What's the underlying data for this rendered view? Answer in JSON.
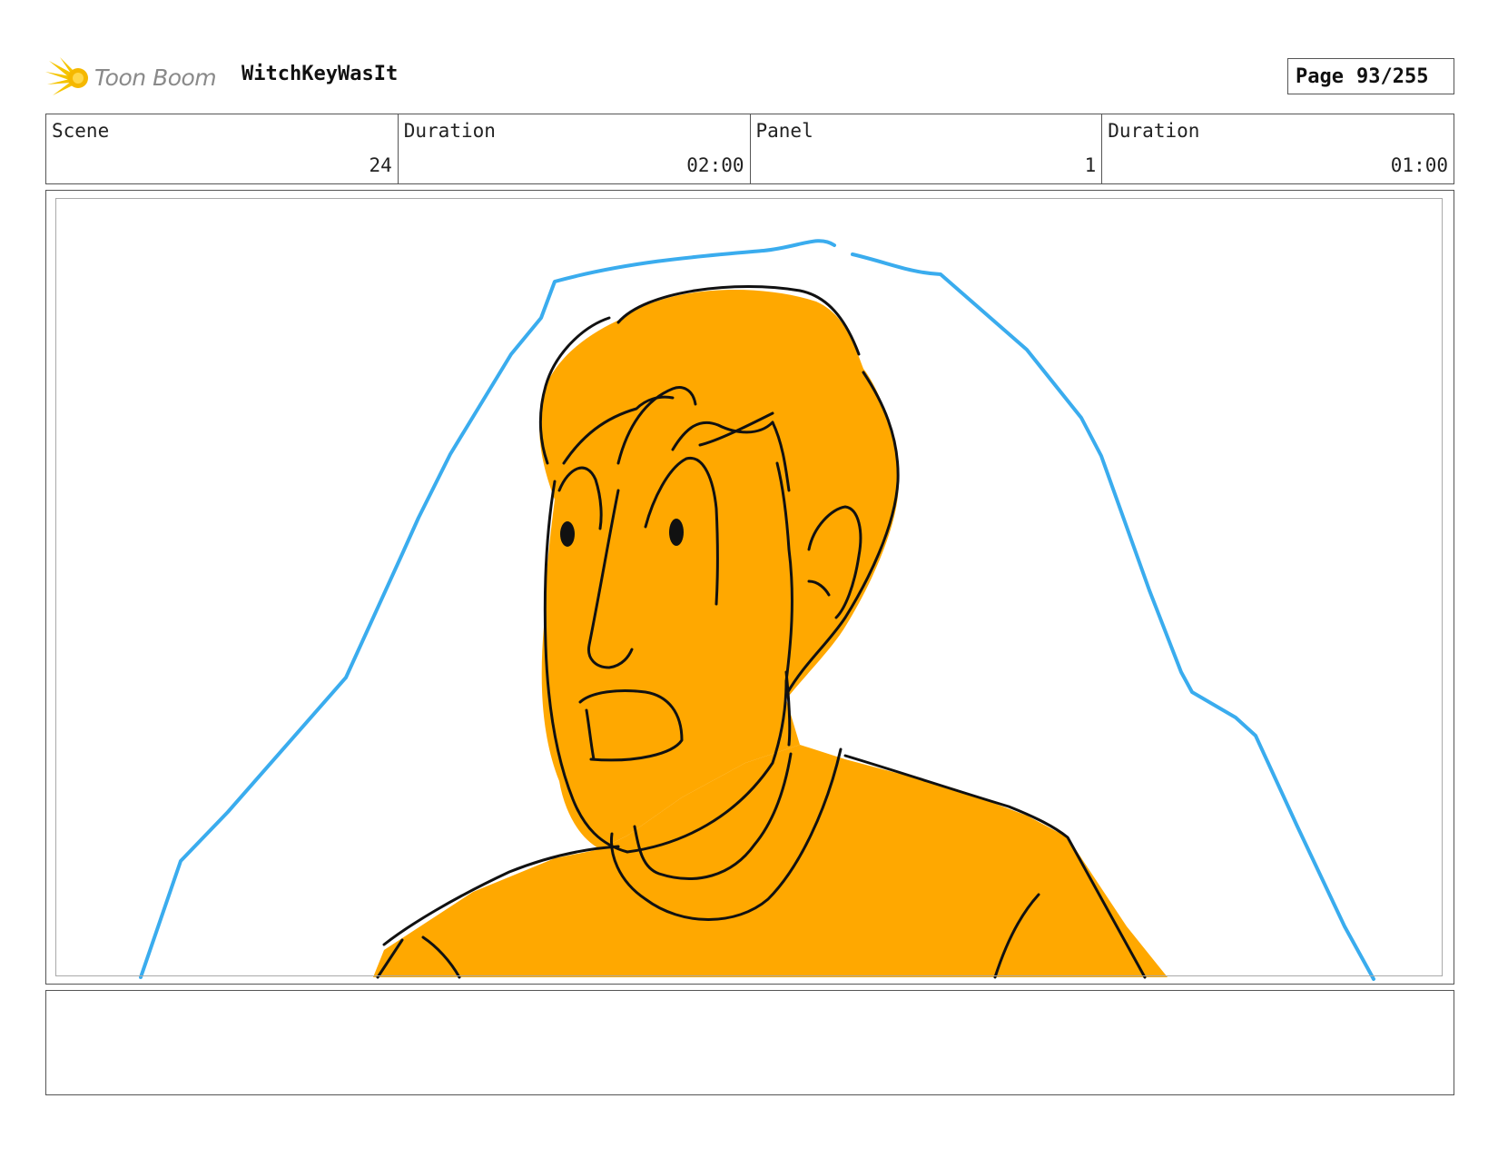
{
  "header": {
    "brand": "Toon Boom",
    "project_title": "WitchKeyWasIt",
    "page_label": "Page",
    "page_value": "93/255"
  },
  "info": {
    "scene_label": "Scene",
    "scene_value": "24",
    "scene_duration_label": "Duration",
    "scene_duration_value": "02:00",
    "panel_label": "Panel",
    "panel_value": "1",
    "panel_duration_label": "Duration",
    "panel_duration_value": "01:00"
  },
  "panel": {
    "colors": {
      "fill": "#FFA800",
      "line": "#111111",
      "outline": "#3AACEE"
    }
  },
  "notes": {
    "text": ""
  },
  "icons": [
    "toon-boom-logo-icon"
  ]
}
